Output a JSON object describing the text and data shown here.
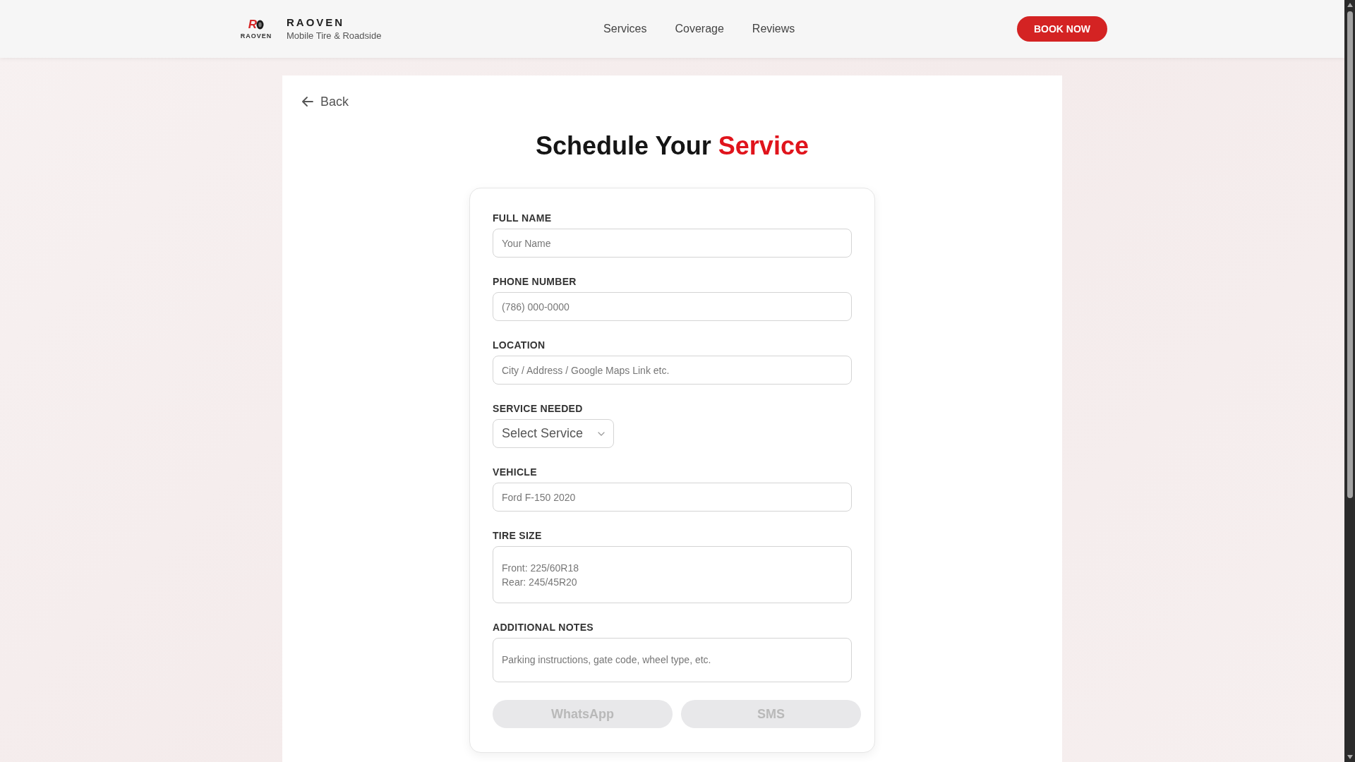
{
  "header": {
    "logo": {
      "letter": "R",
      "wordmark": "RAOVEN"
    },
    "brand": {
      "name": "RAOVEN",
      "tagline": "Mobile Tire & Roadside"
    },
    "nav": [
      "Services",
      "Coverage",
      "Reviews"
    ],
    "cta": "BOOK NOW"
  },
  "back_link": "Back",
  "title": {
    "text": "Schedule Your",
    "highlight": "Service"
  },
  "form": {
    "fields": [
      {
        "kind": "input",
        "label": "FULL NAME",
        "placeholder": "Your Name"
      },
      {
        "kind": "input",
        "label": "PHONE NUMBER",
        "placeholder": "(786) 000-0000"
      },
      {
        "kind": "input",
        "label": "LOCATION",
        "placeholder": "City / Address / Google Maps Link etc."
      },
      {
        "kind": "select",
        "label": "SERVICE NEEDED",
        "value": "Select Service"
      },
      {
        "kind": "input",
        "label": "VEHICLE",
        "placeholder": "Ford F-150 2020"
      },
      {
        "kind": "textarea",
        "label": "TIRE SIZE",
        "placeholder": "Front: 225/60R18\nRear: 245/45R20"
      },
      {
        "kind": "textarea",
        "label": "ADDITIONAL NOTES",
        "placeholder": "Parking instructions, gate code, wheel type, etc."
      }
    ],
    "buttons": [
      {
        "label": "WhatsApp",
        "disabled": true
      },
      {
        "label": "SMS",
        "disabled": true
      }
    ]
  }
}
